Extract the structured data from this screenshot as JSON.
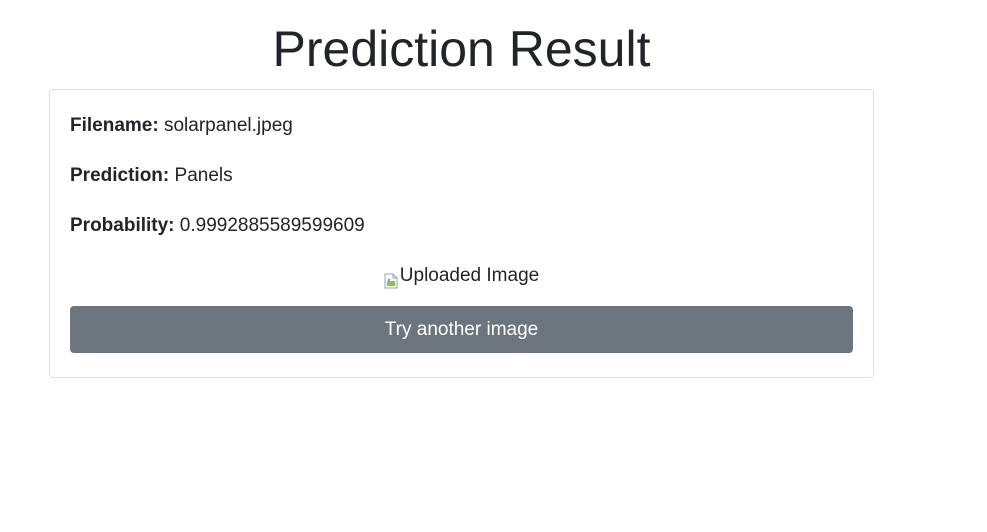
{
  "page": {
    "title": "Prediction Result"
  },
  "result": {
    "filename_label": "Filename:",
    "filename_value": "solarpanel.jpeg",
    "prediction_label": "Prediction:",
    "prediction_value": "Panels",
    "probability_label": "Probability:",
    "probability_value": "0.9992885589599609",
    "image_alt": "Uploaded Image"
  },
  "actions": {
    "try_another_label": "Try another image"
  },
  "colors": {
    "button_bg": "#6c757d",
    "border": "#dee2e6",
    "text": "#212529"
  }
}
